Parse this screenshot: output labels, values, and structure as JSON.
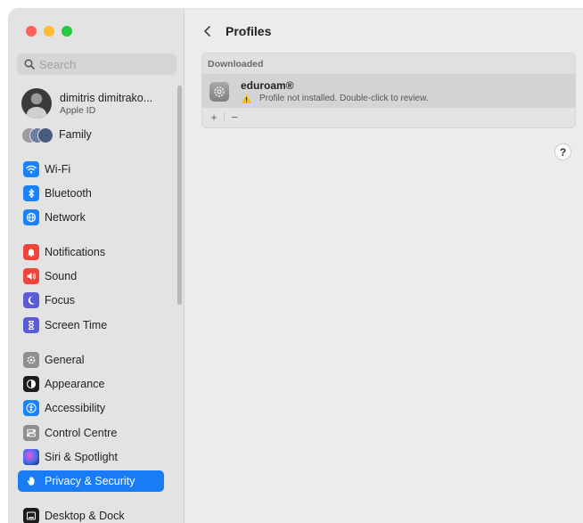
{
  "window": {
    "traffic_lights": {
      "close": "#ff5f57",
      "minimize": "#febc2e",
      "zoom": "#28c840"
    }
  },
  "sidebar": {
    "search": {
      "placeholder": "Search",
      "value": ""
    },
    "profile": {
      "name": "dimitris dimitrako...",
      "subtitle": "Apple ID"
    },
    "family": {
      "label": "Family"
    },
    "items": [
      {
        "label": "Wi-Fi",
        "icon": "wifi-icon",
        "color": "#1a82fb"
      },
      {
        "label": "Bluetooth",
        "icon": "bluetooth-icon",
        "color": "#1a82fb"
      },
      {
        "label": "Network",
        "icon": "globe-icon",
        "color": "#1a82fb"
      },
      {
        "label": "Notifications",
        "icon": "bell-icon",
        "color": "#f2433a"
      },
      {
        "label": "Sound",
        "icon": "speaker-icon",
        "color": "#f2433a"
      },
      {
        "label": "Focus",
        "icon": "moon-icon",
        "color": "#5b5bd6"
      },
      {
        "label": "Screen Time",
        "icon": "hourglass-icon",
        "color": "#5b5bd6"
      },
      {
        "label": "General",
        "icon": "gear-icon",
        "color": "#8e8e93"
      },
      {
        "label": "Appearance",
        "icon": "appearance-icon",
        "color": "#1c1c1e"
      },
      {
        "label": "Accessibility",
        "icon": "accessibility-icon",
        "color": "#1a82fb"
      },
      {
        "label": "Control Centre",
        "icon": "control-centre-icon",
        "color": "#8e8e93"
      },
      {
        "label": "Siri & Spotlight",
        "icon": "siri-icon",
        "color": "#2a2a6e"
      },
      {
        "label": "Privacy & Security",
        "icon": "hand-icon",
        "color": "#1a7cf4"
      },
      {
        "label": "Desktop & Dock",
        "icon": "dock-icon",
        "color": "#1c1c1e"
      }
    ],
    "active_item": "Privacy & Security",
    "active_color": "#1a7cf4"
  },
  "main": {
    "title": "Profiles",
    "section_header": "Downloaded",
    "profiles": [
      {
        "name": "eduroam®",
        "status": "Profile not installed. Double-click to review.",
        "status_icon": "warning-icon"
      }
    ],
    "add_label": "+",
    "remove_label": "−",
    "help_label": "?"
  }
}
